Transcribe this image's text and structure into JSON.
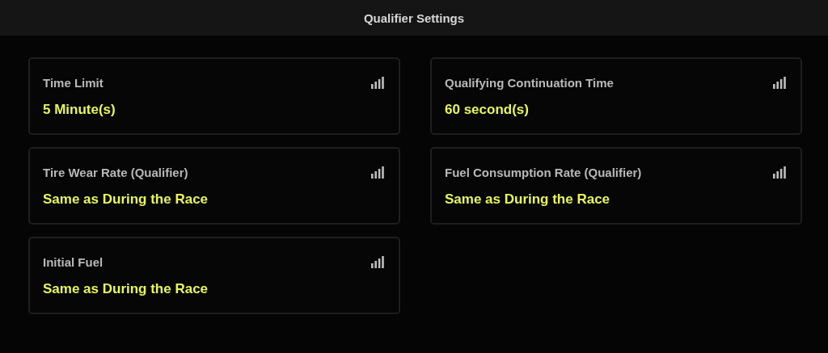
{
  "header": {
    "title": "Qualifier Settings"
  },
  "settings": [
    {
      "label": "Time Limit",
      "value": "5 Minute(s)"
    },
    {
      "label": "Qualifying Continuation Time",
      "value": "60 second(s)"
    },
    {
      "label": "Tire Wear Rate (Qualifier)",
      "value": "Same as During the Race"
    },
    {
      "label": "Fuel Consumption Rate (Qualifier)",
      "value": "Same as During the Race"
    },
    {
      "label": "Initial Fuel",
      "value": "Same as During the Race"
    }
  ]
}
